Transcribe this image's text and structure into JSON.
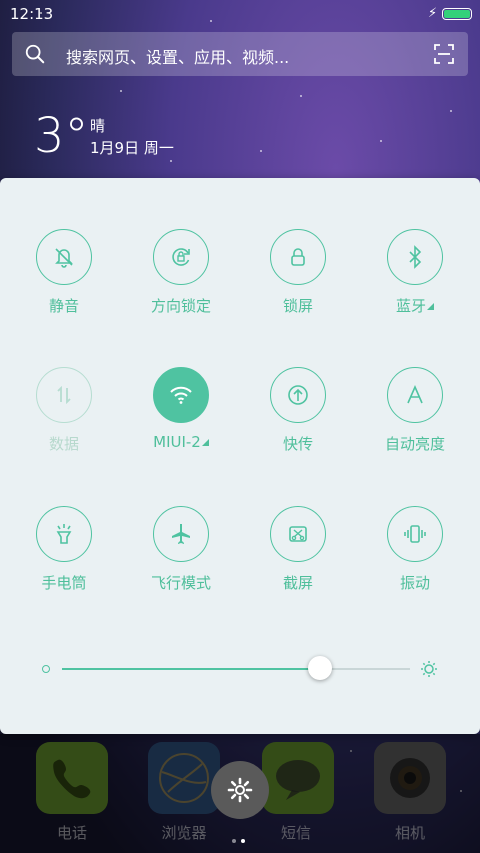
{
  "status_bar": {
    "time": "12:13",
    "battery_level": 1.0,
    "charging": true,
    "battery_color": "#33d17a"
  },
  "search": {
    "placeholder": "搜索网页、设置、应用、视频..."
  },
  "weather": {
    "temperature": "3°",
    "condition": "晴",
    "date": "1月9日 周一"
  },
  "quick_settings": {
    "accent_color": "#4fc3a1",
    "toggles": [
      {
        "label": "静音",
        "icon": "bell-off-icon",
        "state": "off"
      },
      {
        "label": "方向锁定",
        "icon": "rotation-lock-icon",
        "state": "off"
      },
      {
        "label": "锁屏",
        "icon": "lock-icon",
        "state": "off"
      },
      {
        "label": "蓝牙",
        "icon": "bluetooth-icon",
        "state": "off",
        "has_submenu": true
      },
      {
        "label": "数据",
        "icon": "mobile-data-icon",
        "state": "disabled"
      },
      {
        "label": "MIUI-2",
        "icon": "wifi-icon",
        "state": "on",
        "has_submenu": true
      },
      {
        "label": "快传",
        "icon": "quick-transfer-icon",
        "state": "off"
      },
      {
        "label": "自动亮度",
        "icon": "auto-brightness-icon",
        "state": "off"
      },
      {
        "label": "手电筒",
        "icon": "flashlight-icon",
        "state": "off"
      },
      {
        "label": "飞行模式",
        "icon": "airplane-icon",
        "state": "off"
      },
      {
        "label": "截屏",
        "icon": "screenshot-icon",
        "state": "off"
      },
      {
        "label": "振动",
        "icon": "vibrate-icon",
        "state": "off"
      }
    ],
    "brightness": 0.74
  },
  "dock": {
    "apps": [
      {
        "label": "电话",
        "icon": "phone-icon"
      },
      {
        "label": "浏览器",
        "icon": "browser-icon"
      },
      {
        "label": "短信",
        "icon": "messages-icon"
      },
      {
        "label": "相机",
        "icon": "camera-icon"
      }
    ],
    "settings_icon": "gear-icon",
    "page_count": 2,
    "active_page": 2
  }
}
